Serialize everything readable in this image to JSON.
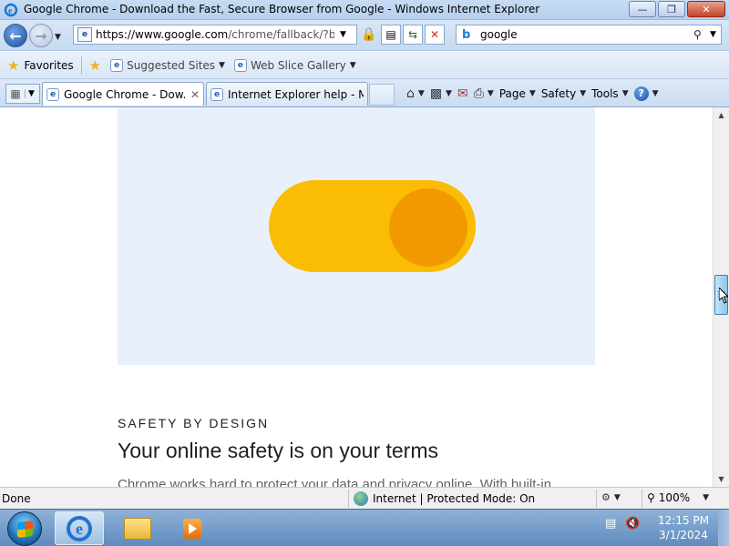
{
  "window": {
    "title": "Google Chrome - Download the Fast, Secure Browser from Google - Windows Internet Explorer",
    "buttons": [
      "—",
      "❐",
      "✕"
    ]
  },
  "addressbar": {
    "url_host": "https://www.google.com",
    "url_rest": "/chrome/fallback/?brand",
    "search_query": "google"
  },
  "favorites_bar": {
    "favorites_label": "Favorites",
    "items": [
      {
        "label": "Suggested Sites"
      },
      {
        "label": "Web Slice Gallery"
      }
    ]
  },
  "tabs": [
    {
      "label": "Google Chrome - Dow...",
      "active": true
    },
    {
      "label": "Internet Explorer help - Mi...",
      "active": false
    }
  ],
  "command_bar": {
    "page_label": "Page",
    "safety_label": "Safety",
    "tools_label": "Tools"
  },
  "page": {
    "eyebrow": "SAFETY BY DESIGN",
    "headline": "Your online safety is on your terms",
    "body": "Chrome works hard to protect your data and privacy online. With built-in"
  },
  "statusbar": {
    "status": "Done",
    "zone": "Internet | Protected Mode: On",
    "zoom": "100%"
  },
  "taskbar": {
    "time": "12:15 PM",
    "date": "3/1/2024"
  },
  "colors": {
    "toggle_track": "#fbbc04",
    "toggle_knob": "#f29900",
    "hero_bg": "#e8f0fb"
  }
}
